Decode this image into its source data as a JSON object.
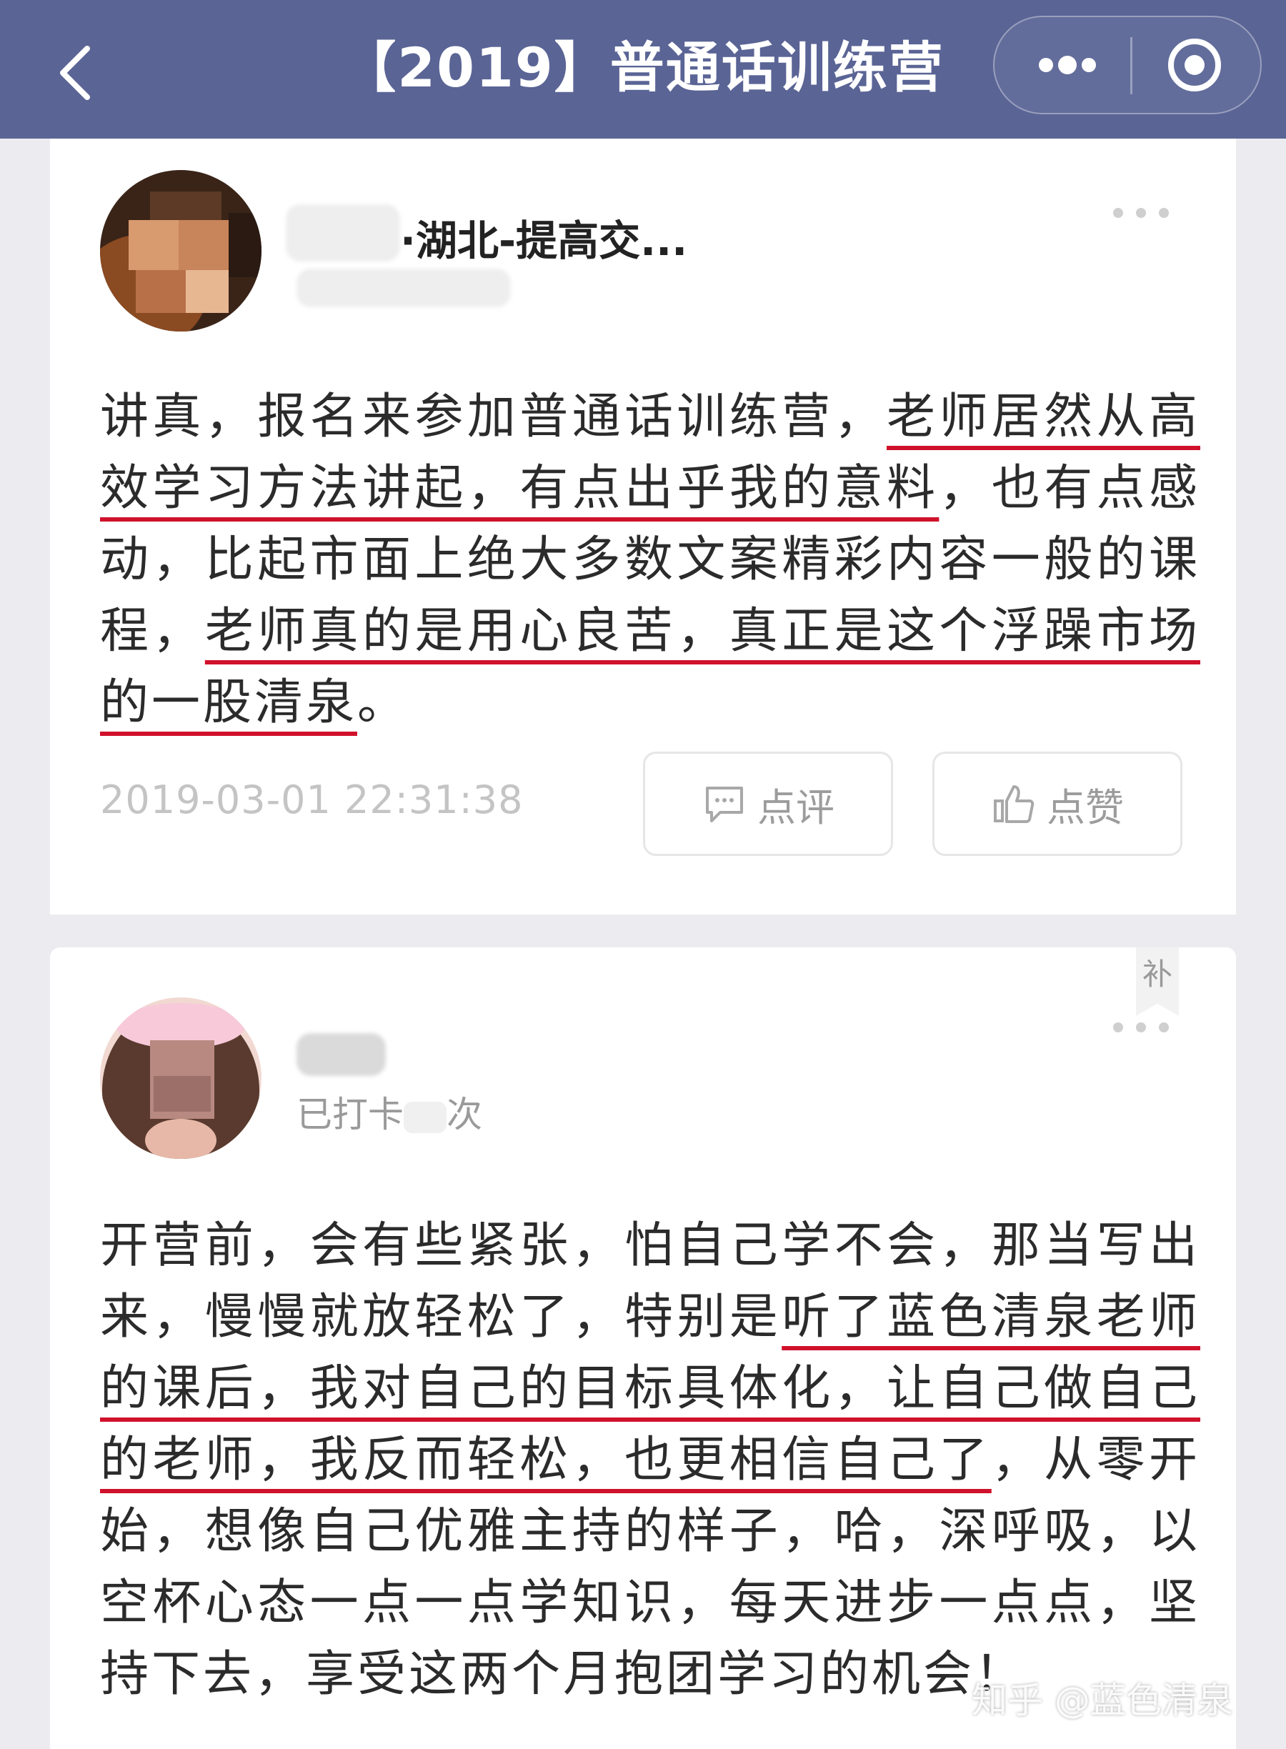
{
  "navbar": {
    "title": "【2019】普通话训练营",
    "bg_color": "#5a6495",
    "back_icon": "chevron-left-icon",
    "more_icon": "more-dots-icon",
    "close_icon": "target-circle-icon"
  },
  "posts": [
    {
      "username_visible": "·湖北-提高交...",
      "sub_visible": "",
      "text_segments": [
        {
          "text": "讲真，报名来参加普通话训练营，",
          "underline": false
        },
        {
          "text": "老师居然从高效学习方法讲起，有点出乎我的意料",
          "underline": true
        },
        {
          "text": "，也有点感动，比起市面上绝大多数文案精彩内容一般的课程，",
          "underline": false
        },
        {
          "text": "老师真的是用心良苦，真正是这个浮躁市场的一股清泉",
          "underline": true
        },
        {
          "text": "。",
          "underline": false
        }
      ],
      "timestamp": "2019-03-01 22:31:38",
      "comment_label": "点评",
      "like_label": "点赞"
    },
    {
      "badge": "补",
      "username_visible": "",
      "sub_prefix": "已打卡",
      "sub_suffix": "次",
      "text_segments": [
        {
          "text": "开营前，会有些紧张，怕自己学不会，那当写出来，慢慢就放轻松了，特别是",
          "underline": false
        },
        {
          "text": "听了蓝色清泉老师的课后，我对自己的目标具体化，让自己做自己的老师，我反而轻松，也更相信自己了",
          "underline": true
        },
        {
          "text": "，从零开始，想像自己优雅主持的样子，哈，深呼吸，以空杯心态一点一点学知识，每天进步一点点，坚持下去，享受这两个月抱团学习的机会！",
          "underline": false
        }
      ]
    }
  ],
  "watermark": "知乎 @蓝色清泉",
  "colors": {
    "underline": "#d0112b",
    "page_bg": "#ececf0"
  }
}
